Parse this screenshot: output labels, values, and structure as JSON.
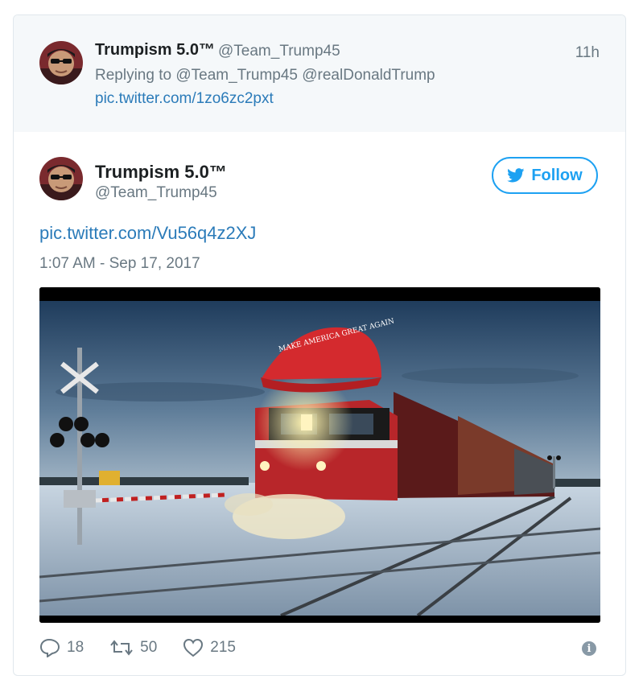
{
  "parent_tweet": {
    "name": "Trumpism 5.0™",
    "handle": "@Team_Trump45",
    "time": "11h",
    "reply_to": "Replying to @Team_Trump45 @realDonaldTrump",
    "link": "pic.twitter.com/1zo6zc2pxt"
  },
  "main_tweet": {
    "name": "Trumpism 5.0™",
    "handle": "@Team_Trump45",
    "follow_label": "Follow",
    "link": "pic.twitter.com/Vu56q4z2XJ",
    "timestamp": "1:07 AM - Sep 17, 2017",
    "photo_text": "MAKE AMERICA GREAT AGAIN"
  },
  "actions": {
    "replies": "18",
    "retweets": "50",
    "likes": "215"
  },
  "colors": {
    "link": "#2b7bb9",
    "twitter_blue": "#1da1f2",
    "muted": "#697882"
  },
  "icons": [
    "avatar-image",
    "twitter-bird-icon",
    "reply-icon",
    "retweet-icon",
    "like-icon",
    "info-icon"
  ]
}
